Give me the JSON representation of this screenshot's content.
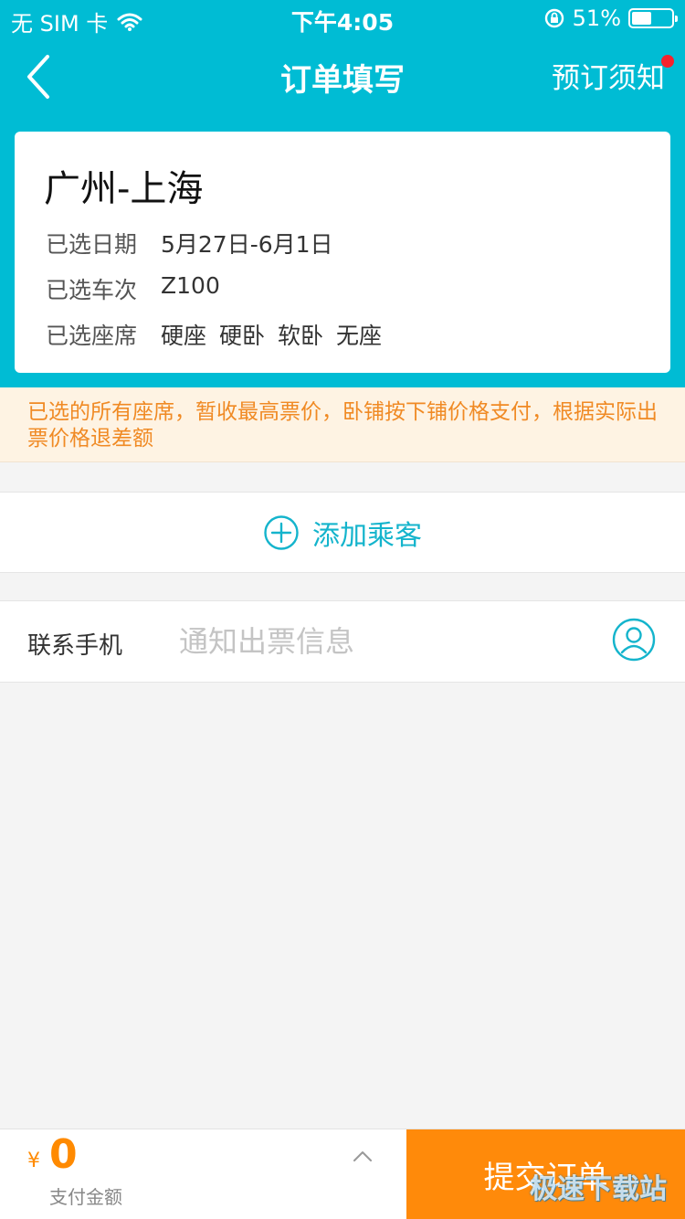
{
  "status_bar": {
    "carrier": "无 SIM 卡",
    "time": "下午4:05",
    "battery_text": "51%",
    "battery_level": 0.51
  },
  "nav": {
    "title": "订单填写",
    "notice_label": "预订须知"
  },
  "trip": {
    "route": "广州-上海",
    "date_label": "已选日期",
    "date_value": "5月27日-6月1日",
    "train_label": "已选车次",
    "train_value": "Z100",
    "seat_label": "已选座席",
    "seats": [
      "硬座",
      "硬卧",
      "软卧",
      "无座"
    ]
  },
  "notice_text": "已选的所有座席，暂收最高票价，卧铺按下铺价格支付，根据实际出票价格退差额",
  "add_passenger_label": "添加乘客",
  "contact": {
    "label": "联系手机",
    "placeholder": "通知出票信息"
  },
  "bottom": {
    "currency": "¥",
    "amount": "0",
    "pay_label": "支付金额",
    "submit_label": "提交订单",
    "watermark": "极速下载站"
  },
  "colors": {
    "header": "#00bcd4",
    "accent_orange": "#ff8a0a",
    "notice_text": "#f08a24",
    "link_teal": "#14b4cc"
  }
}
